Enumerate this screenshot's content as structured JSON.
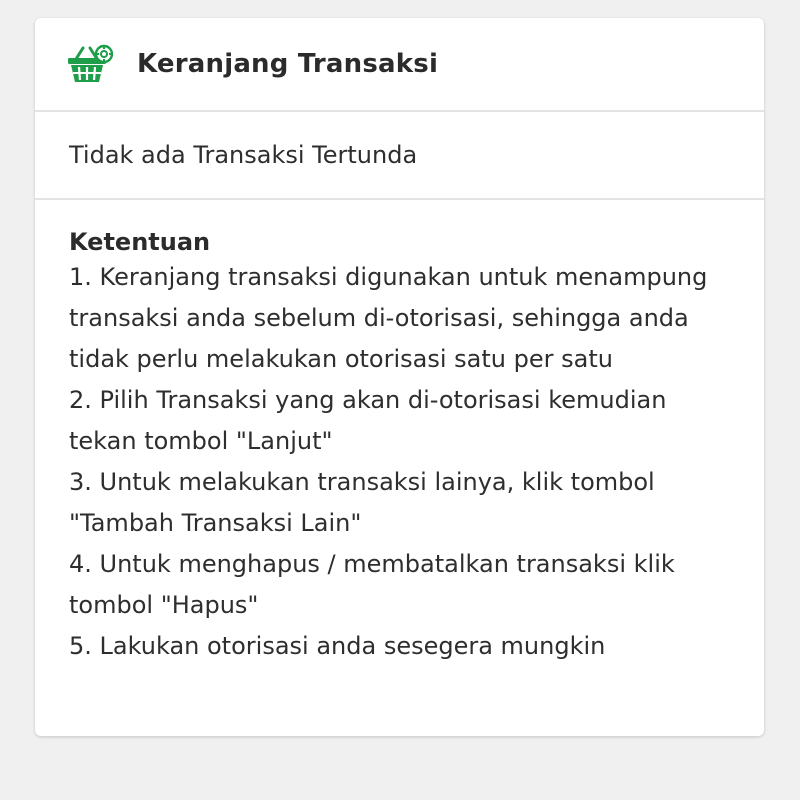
{
  "header": {
    "icon": "shopping-basket-icon",
    "title": "Keranjang Transaksi",
    "accent": "#1e9e4a"
  },
  "status": {
    "text": "Tidak ada Transaksi Tertunda"
  },
  "terms": {
    "heading": "Ketentuan",
    "rules": [
      "1. Keranjang transaksi digunakan untuk menampung transaksi anda sebelum di-otorisasi, sehingga anda tidak perlu melakukan otorisasi satu per satu",
      "2. Pilih Transaksi yang akan di-otorisasi kemudian tekan tombol \"Lanjut\"",
      "3. Untuk melakukan transaksi lainya, klik tombol \"Tambah Transaksi Lain\"",
      "4. Untuk menghapus / membatalkan transaksi klik tombol \"Hapus\"",
      "5. Lakukan otorisasi anda sesegera mungkin"
    ]
  }
}
